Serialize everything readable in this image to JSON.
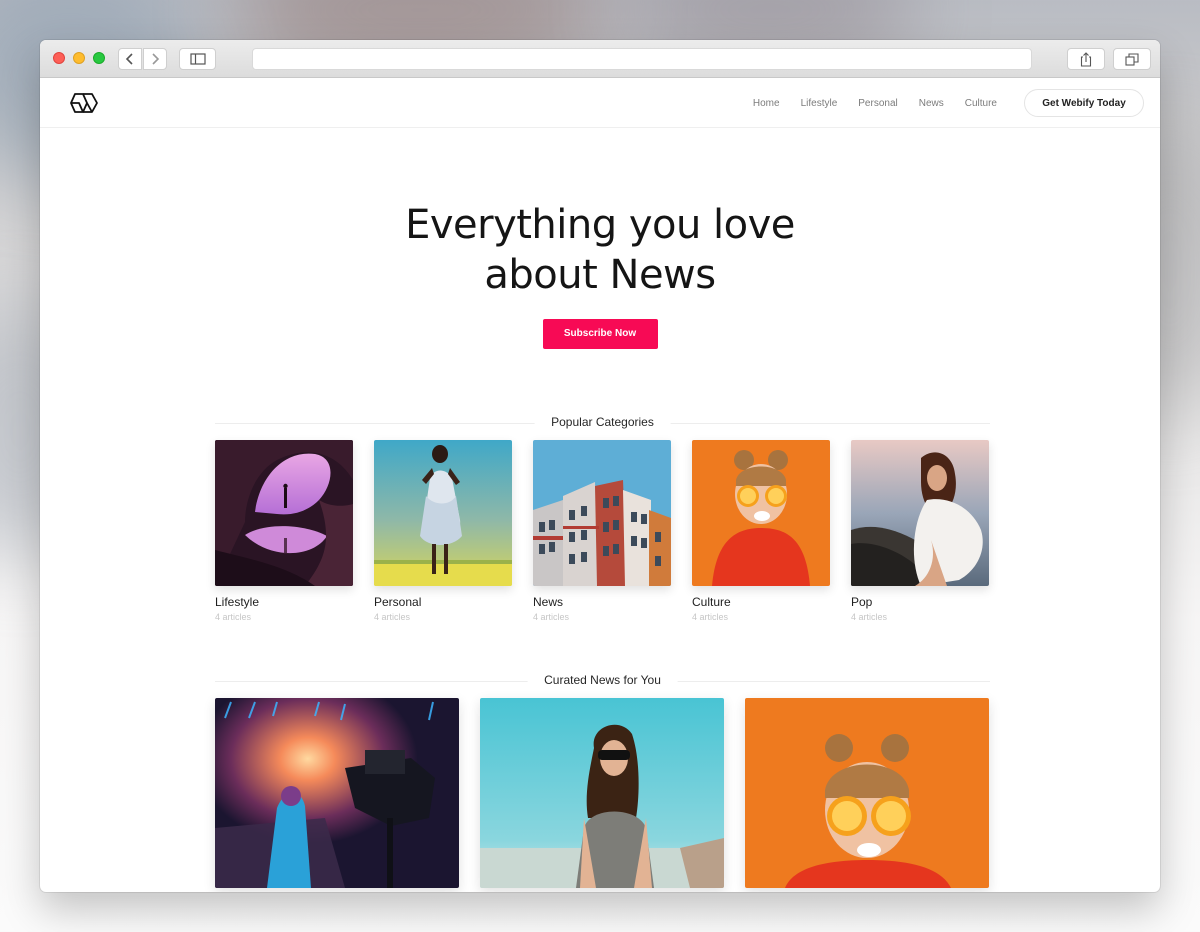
{
  "browser": {
    "back_icon": "chevron-left-icon",
    "forward_icon": "chevron-right-icon",
    "sidebar_icon": "sidebar-icon",
    "share_icon": "share-icon",
    "tabs_icon": "tabs-icon",
    "address": ""
  },
  "header": {
    "logo_icon": "webify-logo-icon",
    "nav": [
      "Home",
      "Lifestyle",
      "Personal",
      "News",
      "Culture"
    ],
    "cta_label": "Get Webify Today"
  },
  "hero": {
    "title_line1": "Everything you love",
    "title_line2": "about News",
    "subscribe_label": "Subscribe Now",
    "accent_color": "#f70a55"
  },
  "popular": {
    "title": "Popular Categories",
    "items": [
      {
        "name": "Lifestyle",
        "count": "4 articles"
      },
      {
        "name": "Personal",
        "count": "4 articles"
      },
      {
        "name": "News",
        "count": "4 articles"
      },
      {
        "name": "Culture",
        "count": "4 articles"
      },
      {
        "name": "Pop",
        "count": "4 articles"
      }
    ]
  },
  "curated": {
    "title": "Curated News for You"
  }
}
